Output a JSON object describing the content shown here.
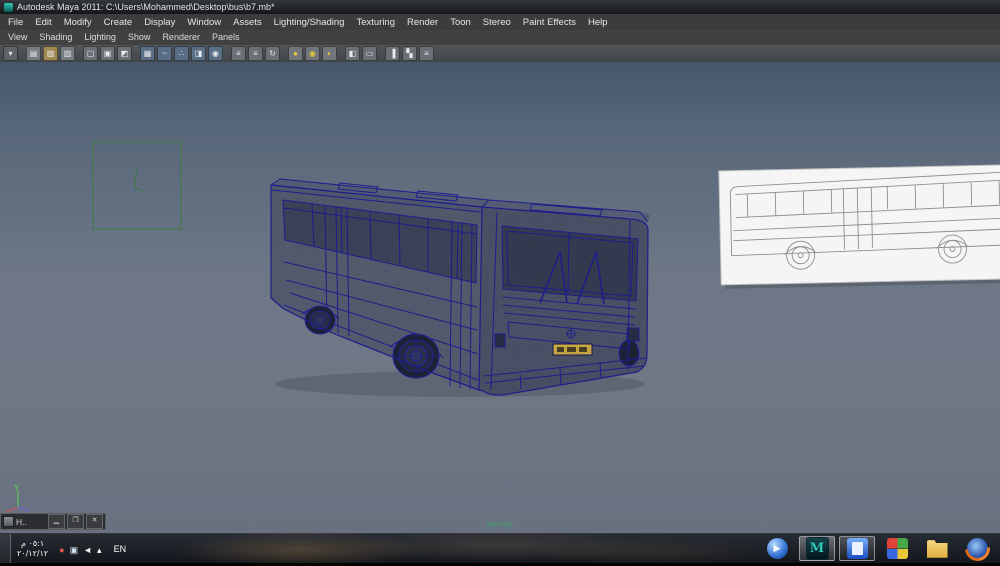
{
  "window": {
    "title": "Autodesk Maya 2011: C:\\Users\\Mohammed\\Desktop\\bus\\b7.mb*"
  },
  "menu_bar": [
    "File",
    "Edit",
    "Modify",
    "Create",
    "Display",
    "Window",
    "Assets",
    "Lighting/Shading",
    "Texturing",
    "Render",
    "Toon",
    "Stereo",
    "Paint Effects",
    "Help"
  ],
  "panel_menu_bar": [
    "View",
    "Shading",
    "Lighting",
    "Show",
    "Renderer",
    "Panels"
  ],
  "toolbar_icons": [
    {
      "name": "selection-mask-menu-icon",
      "color": "#5f646a",
      "glyph": "▾"
    },
    {
      "name": "toolbar-separator",
      "separator": true
    },
    {
      "name": "new-scene-icon",
      "color": "#767c82",
      "glyph": "▤"
    },
    {
      "name": "open-scene-icon",
      "color": "#a08a54",
      "glyph": "▨"
    },
    {
      "name": "save-scene-icon",
      "color": "#767c82",
      "glyph": "▥"
    },
    {
      "name": "toolbar-separator",
      "separator": true
    },
    {
      "name": "select-hierarchy-icon",
      "color": "#6b7076",
      "glyph": "▢"
    },
    {
      "name": "select-object-icon",
      "color": "#6b7076",
      "glyph": "▣"
    },
    {
      "name": "select-component-icon",
      "color": "#6b7076",
      "glyph": "◩"
    },
    {
      "name": "toolbar-separator",
      "separator": true
    },
    {
      "name": "snap-grid-icon",
      "color": "#5a6f86",
      "glyph": "▦"
    },
    {
      "name": "snap-curve-icon",
      "color": "#5a6f86",
      "glyph": "~"
    },
    {
      "name": "snap-point-icon",
      "color": "#5a6f86",
      "glyph": "∴"
    },
    {
      "name": "snap-view-plane-icon",
      "color": "#5a6f86",
      "glyph": "◨"
    },
    {
      "name": "snap-surface-icon",
      "color": "#5a6f86",
      "glyph": "◉"
    },
    {
      "name": "toolbar-separator",
      "separator": true
    },
    {
      "name": "input-connections-icon",
      "color": "#6b7076",
      "glyph": "≡"
    },
    {
      "name": "output-connections-icon",
      "color": "#6b7076",
      "glyph": "≡"
    },
    {
      "name": "construction-history-icon",
      "color": "#6b7076",
      "glyph": "↻"
    },
    {
      "name": "toolbar-separator",
      "separator": true
    },
    {
      "name": "render-current-frame-icon",
      "color": "#71767c",
      "glyph": "●",
      "glyph_color": "#e8c83a"
    },
    {
      "name": "ipr-render-icon",
      "color": "#71767c",
      "glyph": "◉",
      "glyph_color": "#e8c83a"
    },
    {
      "name": "render-settings-icon",
      "color": "#71767c",
      "glyph": "◐",
      "glyph_color": "#e8c83a"
    },
    {
      "name": "toolbar-separator",
      "separator": true
    },
    {
      "name": "hypershade-icon",
      "color": "#6b7076",
      "glyph": "◧"
    },
    {
      "name": "render-view-icon",
      "color": "#6b7076",
      "glyph": "▭"
    },
    {
      "name": "toolbar-separator",
      "separator": true
    },
    {
      "name": "sidebar-toggle-icon",
      "color": "#6b7076",
      "glyph": "▐"
    },
    {
      "name": "channel-box-icon",
      "color": "#6b7076",
      "glyph": "▚"
    },
    {
      "name": "layer-editor-icon",
      "color": "#6b7076",
      "glyph": "≡"
    }
  ],
  "viewport": {
    "camera_label": "persp",
    "axis_y": "y",
    "axis_x": "x",
    "axis_z": "z"
  },
  "minimized_panel": {
    "title": "H..",
    "minimize": "▁",
    "restore": "❐",
    "close": "✕"
  },
  "taskbar": {
    "clock_time": "٠٥:١ م",
    "clock_date": "٢٠/١٢/١٢",
    "language": "EN",
    "tray_icons": [
      {
        "name": "tray-app-icon",
        "glyph": "●",
        "color": "#e05848"
      },
      {
        "name": "network-icon",
        "glyph": "▣",
        "color": "#cfe0f0"
      },
      {
        "name": "volume-icon",
        "glyph": "◄",
        "color": "#f0f0f0"
      },
      {
        "name": "hidden-icons-chevron",
        "glyph": "▴",
        "color": "#ffffff"
      }
    ],
    "apps": [
      {
        "name": "media-player-icon"
      },
      {
        "name": "maya-icon",
        "open": true,
        "active": true
      },
      {
        "name": "blue-document-icon",
        "open": true
      },
      {
        "name": "games-explorer-icon"
      },
      {
        "name": "folder-icon"
      },
      {
        "name": "firefox-icon"
      }
    ]
  },
  "colors": {
    "wireframe": "#1d1d8c",
    "plate_yellow": "#c9a83d",
    "persp_label_green": "#38a06a",
    "curve_green": "#3c7a46",
    "reference_white": "#f4f5f4"
  }
}
